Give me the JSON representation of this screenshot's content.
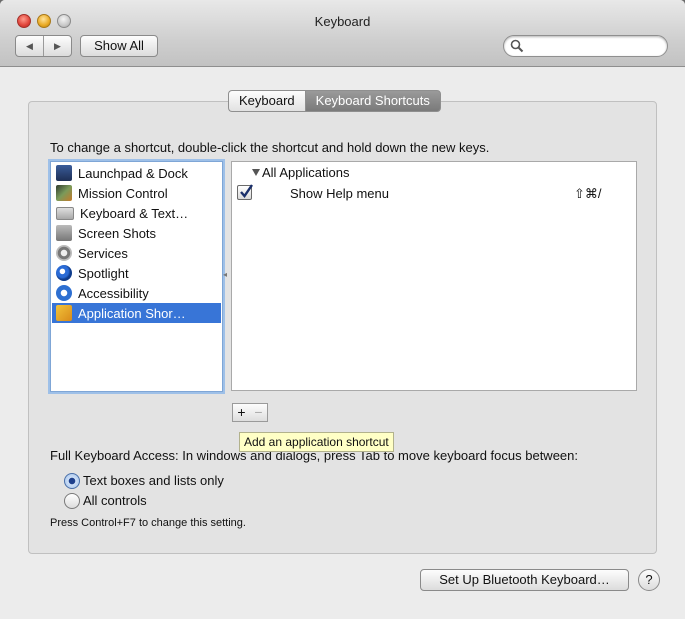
{
  "window": {
    "title": "Keyboard"
  },
  "toolbar": {
    "back_icon": "chevron-left-icon",
    "forward_icon": "chevron-right-icon",
    "show_all_label": "Show All",
    "search_placeholder": ""
  },
  "tabs": [
    {
      "label": "Keyboard",
      "selected": false
    },
    {
      "label": "Keyboard Shortcuts",
      "selected": true
    }
  ],
  "instructions": "To change a shortcut, double-click the shortcut and hold down the new keys.",
  "categories": [
    {
      "label": "Launchpad & Dock",
      "icon": "launchpad-icon",
      "selected": false
    },
    {
      "label": "Mission Control",
      "icon": "mission-control-icon",
      "selected": false
    },
    {
      "label": "Keyboard & Text…",
      "icon": "keyboard-icon",
      "selected": false
    },
    {
      "label": "Screen Shots",
      "icon": "screenshot-icon",
      "selected": false
    },
    {
      "label": "Services",
      "icon": "gear-icon",
      "selected": false
    },
    {
      "label": "Spotlight",
      "icon": "spotlight-icon",
      "selected": false
    },
    {
      "label": "Accessibility",
      "icon": "accessibility-icon",
      "selected": false
    },
    {
      "label": "Application Shor…",
      "icon": "app-store-icon",
      "selected": true
    }
  ],
  "shortcuts": {
    "group_label": "All Applications",
    "items": [
      {
        "label": "Show Help menu",
        "keys": "⇧⌘/",
        "checked": true
      }
    ]
  },
  "buttons": {
    "add": "+",
    "remove": "−"
  },
  "tooltip": "Add an application shortcut",
  "full_keyboard_access": {
    "label": "Full Keyboard Access: In windows and dialogs, press Tab to move keyboard focus between:",
    "options": [
      {
        "label": "Text boxes and lists only",
        "selected": true
      },
      {
        "label": "All controls",
        "selected": false
      }
    ],
    "hint": "Press Control+F7 to change this setting."
  },
  "footer": {
    "bluetooth_button": "Set Up Bluetooth Keyboard…",
    "help_button": "?"
  },
  "colors": {
    "selection": "#3875d7",
    "tooltip_bg": "#ffffc6"
  }
}
